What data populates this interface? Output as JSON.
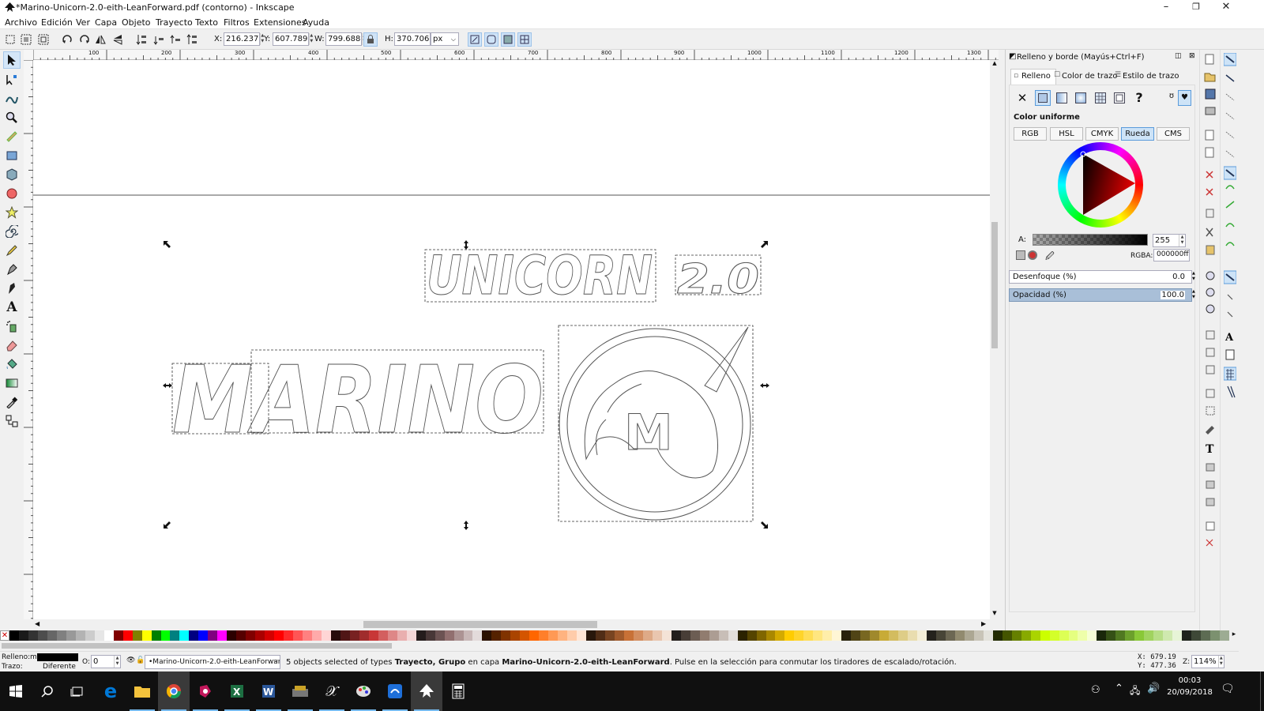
{
  "window": {
    "title": "*Marino-Unicorn-2.0-eith-LeanForward.pdf (contorno) - Inkscape",
    "minimize": "–",
    "maximize": "❐",
    "close": "✕"
  },
  "menu": [
    "Archivo",
    "Edición",
    "Ver",
    "Capa",
    "Objeto",
    "Trayecto",
    "Texto",
    "Filtros",
    "Extensiones",
    "Ayuda"
  ],
  "toolbar": {
    "x_label": "X:",
    "x_value": "216.237",
    "y_label": "Y:",
    "y_value": "607.789",
    "w_label": "W:",
    "w_value": "799.688",
    "h_label": "H:",
    "h_value": "370.706",
    "unit": "px"
  },
  "ruler": {
    "ticks": [
      "100",
      "200",
      "300",
      "400",
      "500",
      "600",
      "700",
      "800",
      "900",
      "1000",
      "1100",
      "1200",
      "1300"
    ]
  },
  "artwork": {
    "word_top": "UNICORN",
    "version": "2.0",
    "word_main": "MARINO",
    "logo_letter": "M"
  },
  "fill_stroke": {
    "panel_title": "Relleno y borde (Mayús+Ctrl+F)",
    "tab_fill": "Relleno",
    "tab_stroke_paint": "Color de trazo",
    "tab_stroke_style": "Estilo de trazo",
    "unknown_paint": "?",
    "section_title": "Color uniforme",
    "modes": [
      "RGB",
      "HSL",
      "CMYK",
      "Rueda",
      "CMS"
    ],
    "selected_mode": "Rueda",
    "alpha_label": "A:",
    "alpha_value": "255",
    "rgba_label": "RGBA:",
    "rgba_value": "000000ff",
    "blur_label": "Desenfoque (%)",
    "blur_value": "0.0",
    "opacity_label": "Opacidad (%)",
    "opacity_value": "100.0"
  },
  "status": {
    "fill_label": "Relleno:",
    "fill_value": "m",
    "stroke_label": "Trazo:",
    "stroke_value": "Diferente",
    "opacity_label": "O:",
    "opacity_value": "0",
    "layer": "•Marino-Unicorn-2.0-eith-LeanForward",
    "message_pre": "5 objects selected of types ",
    "message_types": "Trayecto, Grupo",
    "message_mid": " en capa ",
    "message_layer": "Marino-Unicorn-2.0-eith-LeanForward",
    "message_post": ". Pulse en la selección para conmutar los tiradores de escalado/rotación.",
    "cursor_x": "X: 679.19",
    "cursor_y": "Y: 477.36",
    "zoom_label": "Z:",
    "zoom_value": "114%"
  },
  "taskbar": {
    "time": "00:03",
    "date": "20/09/2018"
  },
  "colors": {
    "selection_accent": "#5a9bdb",
    "taskbar_bg": "#101010",
    "edge_blue": "#0078d7"
  },
  "palette": [
    "#000000",
    "#1a1a1a",
    "#333333",
    "#4d4d4d",
    "#666666",
    "#808080",
    "#999999",
    "#b3b3b3",
    "#cccccc",
    "#e6e6e6",
    "#ffffff",
    "#800000",
    "#ff0000",
    "#808000",
    "#ffff00",
    "#008000",
    "#00ff00",
    "#008080",
    "#00ffff",
    "#000080",
    "#0000ff",
    "#800080",
    "#ff00ff",
    "#2b0000",
    "#550000",
    "#800000",
    "#aa0000",
    "#d40000",
    "#ff0000",
    "#ff2a2a",
    "#ff5555",
    "#ff8080",
    "#ffaaaa",
    "#ffd5d5",
    "#280b0b",
    "#501616",
    "#782121",
    "#a02c2c",
    "#c83737",
    "#d35f5f",
    "#de8787",
    "#e9afaf",
    "#f4d7d7",
    "#241c1c",
    "#483737",
    "#6c5353",
    "#916f6f",
    "#ac9393",
    "#c8b7b7",
    "#e3dbdb",
    "#2b1100",
    "#552200",
    "#803300",
    "#aa4400",
    "#d45500",
    "#ff6600",
    "#ff7f2a",
    "#ff9955",
    "#ffb380",
    "#ffccaa",
    "#ffe6d5",
    "#28170b",
    "#502d16",
    "#784421",
    "#a05a2c",
    "#c87137",
    "#d38d5f",
    "#deaa87",
    "#e9c6af",
    "#f4e3d7",
    "#241f1c",
    "#483e37",
    "#6c5d53",
    "#917c6f",
    "#ac9d93",
    "#c8beb7",
    "#e3dedb",
    "#2b2200",
    "#554400",
    "#806600",
    "#aa8800",
    "#d4aa00",
    "#ffcc00",
    "#ffd42a",
    "#ffdd55",
    "#ffe680",
    "#ffeeaa",
    "#fff6d5",
    "#28220b",
    "#504416",
    "#786721",
    "#a0892c",
    "#c8ab37",
    "#d3bc5f",
    "#decd87",
    "#e9ddaf",
    "#f4eed7",
    "#24221c",
    "#484537",
    "#6c6753",
    "#918a6f",
    "#aca793",
    "#c8c4b7",
    "#e3e2db",
    "#222b00",
    "#445500",
    "#668000",
    "#88aa00",
    "#aad400",
    "#ccff00",
    "#d4ff2a",
    "#ddff55",
    "#e5ff80",
    "#eeffaa",
    "#f6ffd5",
    "#1a280b",
    "#355016",
    "#507821",
    "#6ca02c",
    "#89c837",
    "#a0d35f",
    "#b7de87",
    "#cfe9af",
    "#e7f4d7",
    "#1f241c",
    "#3e4837",
    "#5d6c53",
    "#7c916f",
    "#9dac93"
  ]
}
